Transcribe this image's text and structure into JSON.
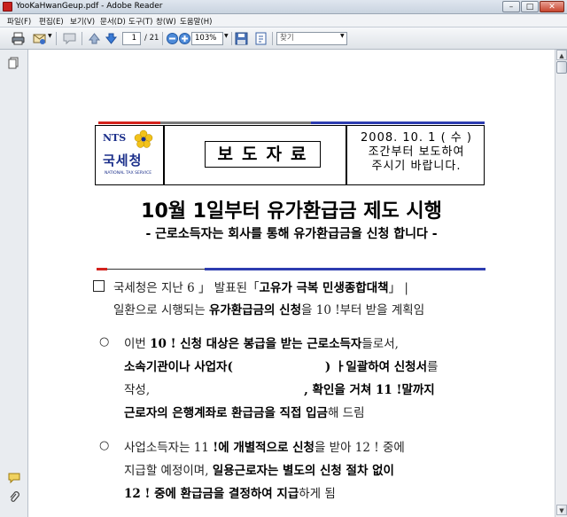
{
  "window": {
    "title": "YooKaHwanGeup.pdf - Adobe Reader",
    "controls": {
      "minimize": "–",
      "maximize": "□",
      "close": "✕"
    }
  },
  "menu": {
    "items": [
      "파일(F)",
      "편집(E)",
      "보기(V)",
      "문서(D)",
      "도구(T)",
      "창(W)",
      "도움말(H)"
    ]
  },
  "toolbar": {
    "page_current": "1",
    "page_total": "/ 21",
    "zoom": "103%",
    "find_placeholder": "찾기",
    "icons": [
      "print-icon",
      "email-icon",
      "comment-icon",
      "previous-page-icon",
      "next-page-icon",
      "zoom-out-icon",
      "zoom-in-icon",
      "save-icon",
      "fit-page-icon"
    ]
  },
  "navpane": {
    "icons": [
      "pages-icon",
      "comments-icon",
      "attachments-icon"
    ]
  },
  "document": {
    "logo": {
      "abbr": "NTS",
      "korean": "국세청",
      "english": "NATIONAL TAX SERVICE"
    },
    "press_label": "보도자료",
    "embargo": [
      "2008. 10. 1 ( 수 )",
      "조간부터 보도하여",
      "주시기 바랍니다."
    ],
    "title": "10월 1일부터 유가환급금 제도 시행",
    "subtitle": "- 근로소득자는 회사를 통해 유가환급금을 신청 합니다 -",
    "paragraph1": {
      "line1_a": "국세청은 지난 6 ",
      "line1_b": "」 발표된「",
      "line1_c": "고유가 극복 민생종합대책",
      "line1_d": "」 |",
      "line2_a": "일환으로 시행되는 ",
      "line2_b": "유가환급금의 신청",
      "line2_c": "을 10 ",
      "line2_d": "!부터 받을 계획임"
    },
    "bullet1": {
      "marker": "○",
      "line1_a": "이번 ",
      "line1_b": "10 ! 신청 대상은 봉급을 받는 근로소득자",
      "line1_c": "들로서,",
      "line2_a": "소속기관이나 사업자(",
      "line2_b": ")",
      "line2_c": " ㅏ일괄하여 신청서",
      "line2_d": "를",
      "line3_a": "작성,",
      "line3_b": ", 확인을 거쳐 11 !말까지",
      "line4_a": "근로자의 은행계좌로 환급금을 직접 입금",
      "line4_b": "해 드림"
    },
    "bullet2": {
      "marker": "○",
      "line1_a": "사업소득자는 11 ",
      "line1_b": "!에 개별적으로 신청",
      "line1_c": "을 받아 12 ! 중에",
      "line2_a": "지급할 예정이며, ",
      "line2_b": "일용근로자는 별도의 신청 절차 없이",
      "line3_a": "12 ! 중에 환급금을 결정하여 지급",
      "line3_b": "하게 됨"
    }
  }
}
